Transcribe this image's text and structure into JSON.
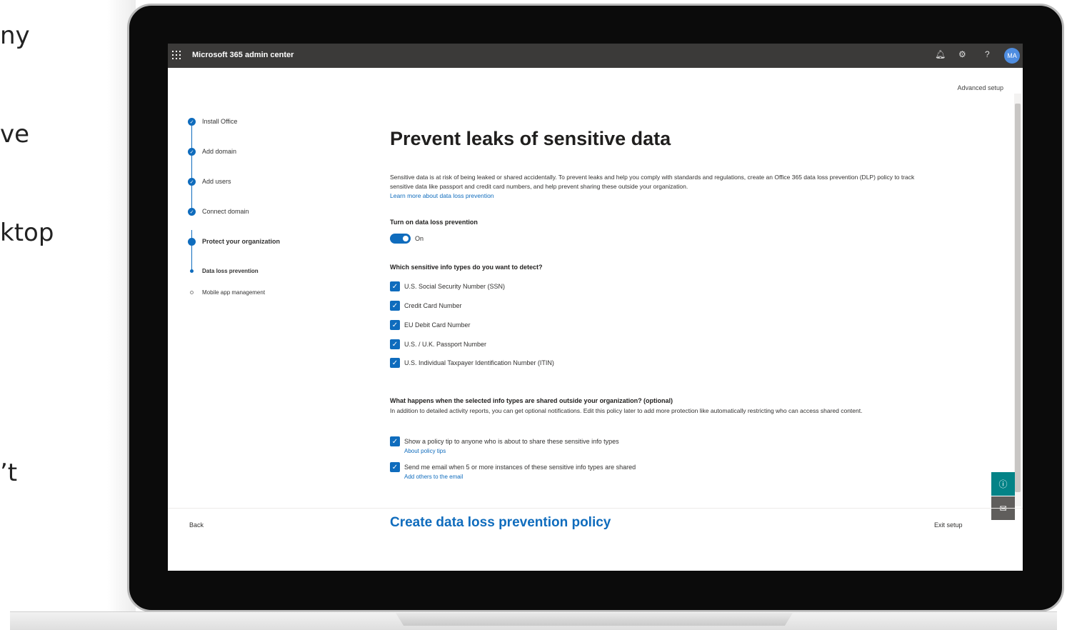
{
  "slide": {
    "fragments": [
      "ny",
      "ve",
      "ktop",
      "’t"
    ]
  },
  "app": {
    "title": "Microsoft 365 admin center",
    "avatar": "MA",
    "icons": [
      "bell-icon",
      "gear-icon",
      "help-icon"
    ]
  },
  "advanced_setup": "Advanced setup",
  "steps": [
    {
      "label": "Install Office"
    },
    {
      "label": "Add domain"
    },
    {
      "label": "Add users"
    },
    {
      "label": "Connect domain"
    },
    {
      "label": "Protect your organization"
    },
    {
      "label": "Data loss prevention"
    },
    {
      "label": "Mobile app management"
    }
  ],
  "main": {
    "title": "Prevent leaks of sensitive data",
    "description": "Sensitive data is at risk of being leaked or shared accidentally. To prevent leaks and help you comply with standards and regulations, create an Office 365 data loss prevention (DLP) policy to track sensitive data like passport and credit card numbers, and help prevent sharing these outside your organization.",
    "learn_more": "Learn more about data loss prevention",
    "toggle_heading": "Turn on data loss prevention",
    "toggle_state": "On",
    "types_heading": "Which sensitive info types do you want to detect?",
    "types": [
      "U.S. Social Security Number (SSN)",
      "Credit Card Number",
      "EU Debit Card Number",
      "U.S. / U.K. Passport Number",
      "U.S. Individual Taxpayer Identification Number (ITIN)"
    ],
    "shared_heading": "What happens when the selected info types are shared outside your organization? (optional)",
    "shared_desc": "In addition to detailed activity reports, you can get optional notifications. Edit this policy later to add more protection like automatically restricting who can access shared content.",
    "options": [
      {
        "label": "Show a policy tip to anyone who is about to share these sensitive info types",
        "link": "About policy tips"
      },
      {
        "label": "Send me email when 5 or more instances of these sensitive info types are shared",
        "link": "Add others to the email"
      }
    ]
  },
  "footer": {
    "back": "Back",
    "primary": "Create data loss prevention policy",
    "exit": "Exit setup"
  },
  "colors": {
    "accent": "#0f6cbd",
    "topbar": "#3b3a39",
    "help_float": "#038387"
  }
}
